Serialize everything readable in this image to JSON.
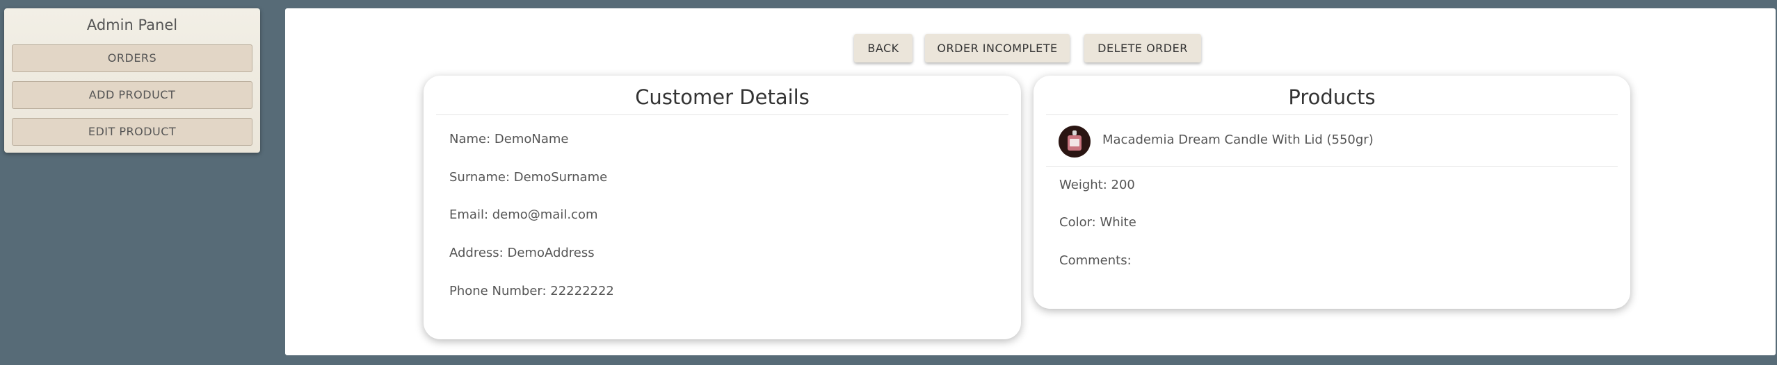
{
  "sidebar": {
    "title": "Admin Panel",
    "items": [
      {
        "label": "ORDERS"
      },
      {
        "label": "ADD PRODUCT"
      },
      {
        "label": "EDIT PRODUCT"
      }
    ]
  },
  "toolbar": {
    "back_label": "BACK",
    "incomplete_label": "ORDER INCOMPLETE",
    "delete_label": "DELETE ORDER"
  },
  "customer": {
    "title": "Customer Details",
    "name": "Name: DemoName",
    "surname": "Surname: DemoSurname",
    "email": "Email: demo@mail.com",
    "address": "Address: DemoAddress",
    "phone": "Phone Number: 22222222"
  },
  "products": {
    "title": "Products",
    "items": [
      {
        "name": "Macademia Dream Candle With Lid (550gr)",
        "icon": "candle-jar-thumbnail",
        "weight": "Weight: 200",
        "color": "Color: White",
        "comments": "Comments:"
      }
    ]
  },
  "colors": {
    "page_background": "#576b77",
    "sidebar_button": "#e2d6c6",
    "action_button": "#ebe5da"
  }
}
